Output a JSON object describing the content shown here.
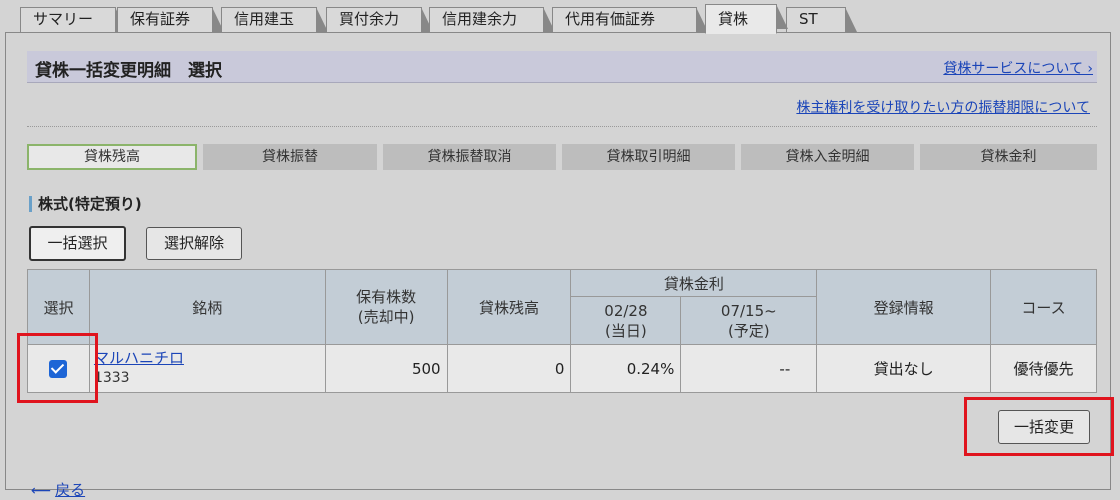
{
  "tabs": [
    {
      "label": "サマリー"
    },
    {
      "label": "保有証券"
    },
    {
      "label": "信用建玉"
    },
    {
      "label": "買付余力"
    },
    {
      "label": "信用建余力"
    },
    {
      "label": "代用有価証券"
    },
    {
      "label": "貸株"
    },
    {
      "label": "ST"
    }
  ],
  "header": {
    "title": "貸株一括変更明細　選択",
    "service_link": "貸株サービスについて ›",
    "rights_link": "株主権利を受け取りたい方の振替期限について"
  },
  "subnav": [
    {
      "label": "貸株残高"
    },
    {
      "label": "貸株振替"
    },
    {
      "label": "貸株振替取消"
    },
    {
      "label": "貸株取引明細"
    },
    {
      "label": "貸株入金明細"
    },
    {
      "label": "貸株金利"
    }
  ],
  "section": {
    "title": "株式(特定預り)"
  },
  "buttons": {
    "bulk_select": "一括選択",
    "clear_select": "選択解除",
    "bulk_change": "一括変更"
  },
  "table": {
    "headers": {
      "select": "選択",
      "name": "銘柄",
      "shares": "保有株数",
      "shares_sub": "(売却中)",
      "balance": "貸株残高",
      "rate": "貸株金利",
      "rate_current_date": "02/28",
      "rate_current_sub": "(当日)",
      "rate_next_date": "07/15~",
      "rate_next_sub": "(予定)",
      "registration": "登録情報",
      "course": "コース"
    },
    "rows": [
      {
        "checked": true,
        "name": "マルハニチロ",
        "code": "1333",
        "shares": "500",
        "balance": "0",
        "rate_current": "0.24%",
        "rate_next": "--",
        "registration": "貸出なし",
        "course": "優待優先"
      }
    ]
  },
  "back": {
    "arrow": "⟵",
    "label": "戻る"
  }
}
